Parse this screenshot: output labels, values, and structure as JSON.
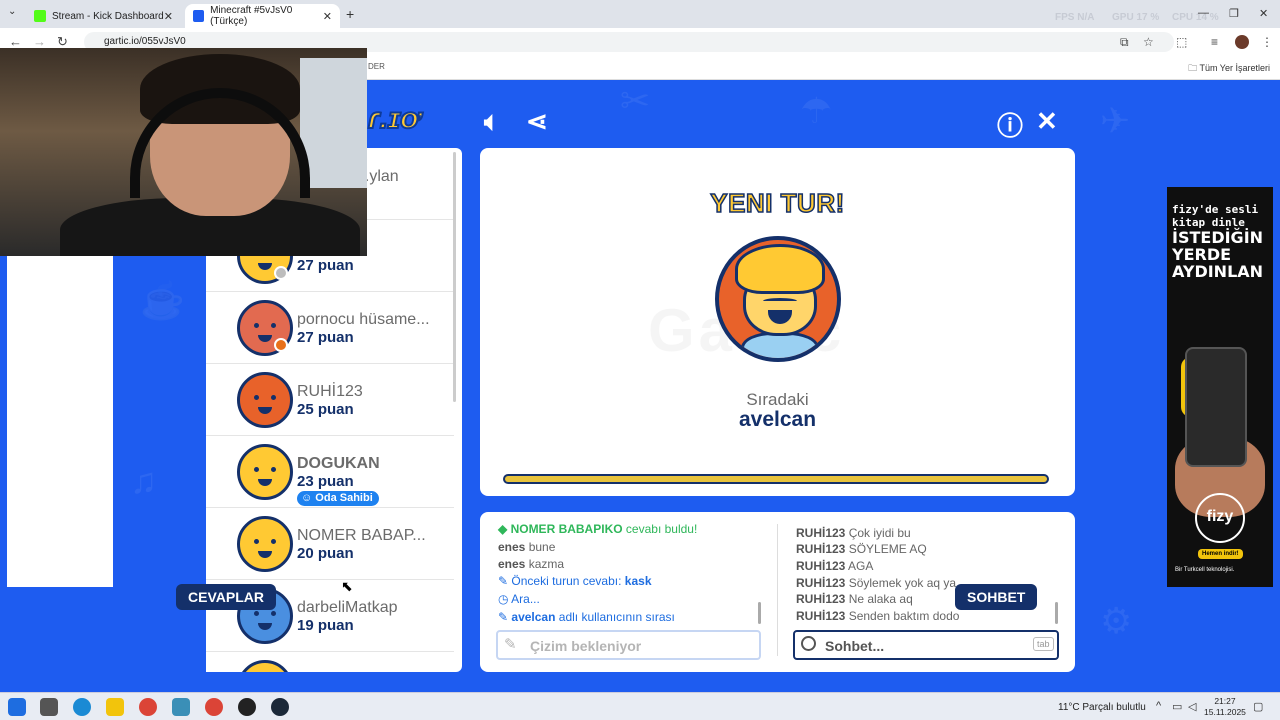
{
  "browser": {
    "tabs": [
      {
        "label": "Stream - Kick Dashboard"
      },
      {
        "label": "Minecraft #5vJsV0 (Türkçe)"
      }
    ],
    "new_tab": "+",
    "url": "gartic.io/055vJsV0",
    "bookmark_partial": "DER",
    "all_bookmarks": "Tüm Yer İşaretleri",
    "sys_stats": {
      "fps_label": "FPS",
      "fps": "N/A",
      "gpu_label": "GPU",
      "gpu": "17 %",
      "cpu_label": "CPU",
      "cpu": "14 %"
    }
  },
  "players": [
    {
      "name": "...ylan",
      "score": "",
      "owner": false
    },
    {
      "name": "",
      "score": "27 puan",
      "owner": false
    },
    {
      "name": "pornocu hüsame...",
      "score": "27 puan",
      "owner": false
    },
    {
      "name": "RUHİ123",
      "score": "25 puan",
      "owner": false
    },
    {
      "name": "DOGUKAN",
      "score": "23 puan",
      "owner": true
    },
    {
      "name": "NOMER BABAP...",
      "score": "20 puan",
      "owner": false
    },
    {
      "name": "darbeliMatkap",
      "score": "19 puan",
      "owner": false
    }
  ],
  "owner_badge": "Oda Sahibi",
  "round": {
    "title": "YENI TUR!",
    "next_label": "Sıradaki",
    "next_name": "avelcan",
    "progress": 1.0
  },
  "tabs": {
    "answers": "CEVAPLAR",
    "chat": "SOHBET"
  },
  "answers": [
    {
      "user": "NOMER BABAPIKO",
      "text": "cevabı buldu!",
      "type": "found"
    },
    {
      "user": "enes",
      "text": "bune",
      "type": "msg"
    },
    {
      "user": "enes",
      "text": "kazma",
      "type": "msg"
    },
    {
      "prefix": "Önceki turun cevabı:",
      "value": "kask",
      "type": "prev"
    },
    {
      "prefix": "Ara...",
      "type": "hint"
    },
    {
      "value": "avelcan",
      "suffix": "adlı kullanıcının sırası",
      "type": "turn"
    }
  ],
  "chat": [
    {
      "user": "RUHİ123",
      "text": "Çok iyidi bu"
    },
    {
      "user": "RUHİ123",
      "text": "SÖYLEME AQ"
    },
    {
      "user": "RUHİ123",
      "text": "AGA"
    },
    {
      "user": "RUHİ123",
      "text": "Söylemek yok aq ya"
    },
    {
      "user": "RUHİ123",
      "text": "Ne alaka aq"
    },
    {
      "user": "RUHİ123",
      "text": "Senden baktım dodo"
    }
  ],
  "inputs": {
    "draw_placeholder": "Çizim bekleniyor",
    "chat_placeholder": "Sohbet...",
    "tab_key": "tab"
  },
  "ad": {
    "line1": "fizy'de sesli",
    "line2": "kitap dinle",
    "big1": "İSTEDİĞİN",
    "big2": "YERDE",
    "big3": "AYDINLAN",
    "brand": "fizy",
    "cta": "Hemen indir!",
    "footer": "Bir Turkcell teknolojisi."
  },
  "taskbar": {
    "weather": "11°C  Parçalı bulutlu",
    "time": "21:27",
    "date": "15.11.2025"
  },
  "colors": {
    "background": "#1e5cf0",
    "navy": "#14306a",
    "yellow": "#ffc933",
    "owner_badge": "#1e82f0"
  }
}
